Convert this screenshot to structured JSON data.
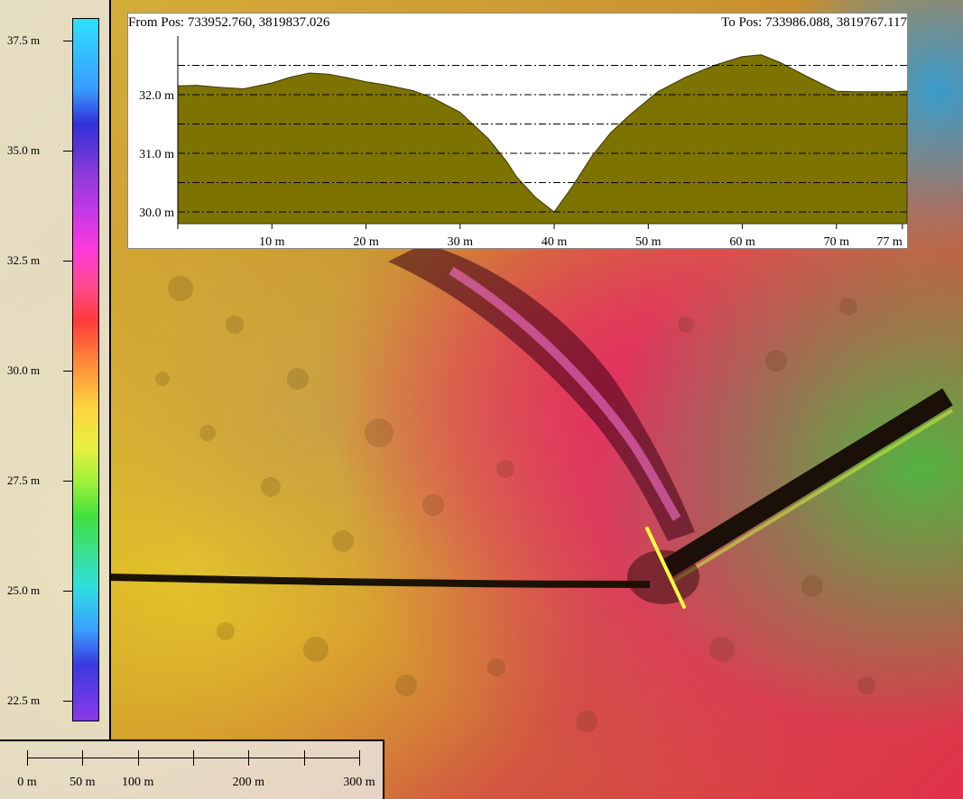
{
  "map": {
    "legend": {
      "labels": [
        "37.5 m",
        "35.0 m",
        "32.5 m",
        "30.0 m",
        "27.5 m",
        "25.0 m",
        "22.5 m"
      ],
      "values": [
        37.5,
        35.0,
        32.5,
        30.0,
        27.5,
        25.0,
        22.5
      ]
    },
    "profile": {
      "from_label": "From Pos: 733952.760, 3819837.026",
      "to_label": "To Pos: 733986.088, 3819767.117",
      "fill_color": "#7d7300"
    },
    "scale_bar": {
      "labels": [
        "0 m",
        "50 m",
        "100 m",
        "200 m",
        "300 m"
      ],
      "values": [
        0,
        50,
        100,
        200,
        300
      ]
    },
    "section_line_color": "#ffff40"
  },
  "chart_data": {
    "type": "area",
    "xlabel": "",
    "ylabel": "",
    "x_ticks": [
      10,
      20,
      30,
      40,
      50,
      60,
      70,
      77
    ],
    "x_tick_labels": [
      "10 m",
      "20 m",
      "30 m",
      "40 m",
      "50 m",
      "60 m",
      "70 m",
      "77 m"
    ],
    "y_ticks": [
      30.0,
      31.0,
      32.0
    ],
    "y_tick_labels": [
      "30.0 m",
      "31.0 m",
      "32.0 m"
    ],
    "y_gridlines": [
      30.0,
      30.5,
      31.0,
      31.5,
      32.0,
      32.5
    ],
    "xlim": [
      0,
      77.5
    ],
    "ylim": [
      29.8,
      33.0
    ],
    "grid": true,
    "x": [
      0,
      2,
      4,
      7,
      10,
      12,
      14,
      16,
      18,
      20,
      22,
      25,
      27,
      30,
      33,
      35,
      36,
      38,
      40,
      42,
      44,
      46,
      48,
      51,
      54,
      57,
      60,
      62,
      64,
      67,
      70,
      72,
      74,
      76,
      77.5
    ],
    "y": [
      32.15,
      32.16,
      32.13,
      32.1,
      32.2,
      32.3,
      32.37,
      32.35,
      32.29,
      32.22,
      32.17,
      32.07,
      31.95,
      31.7,
      31.25,
      30.85,
      30.6,
      30.25,
      30.0,
      30.45,
      30.95,
      31.35,
      31.65,
      32.05,
      32.3,
      32.5,
      32.65,
      32.68,
      32.55,
      32.3,
      32.06,
      32.05,
      32.05,
      32.05,
      32.06
    ]
  }
}
